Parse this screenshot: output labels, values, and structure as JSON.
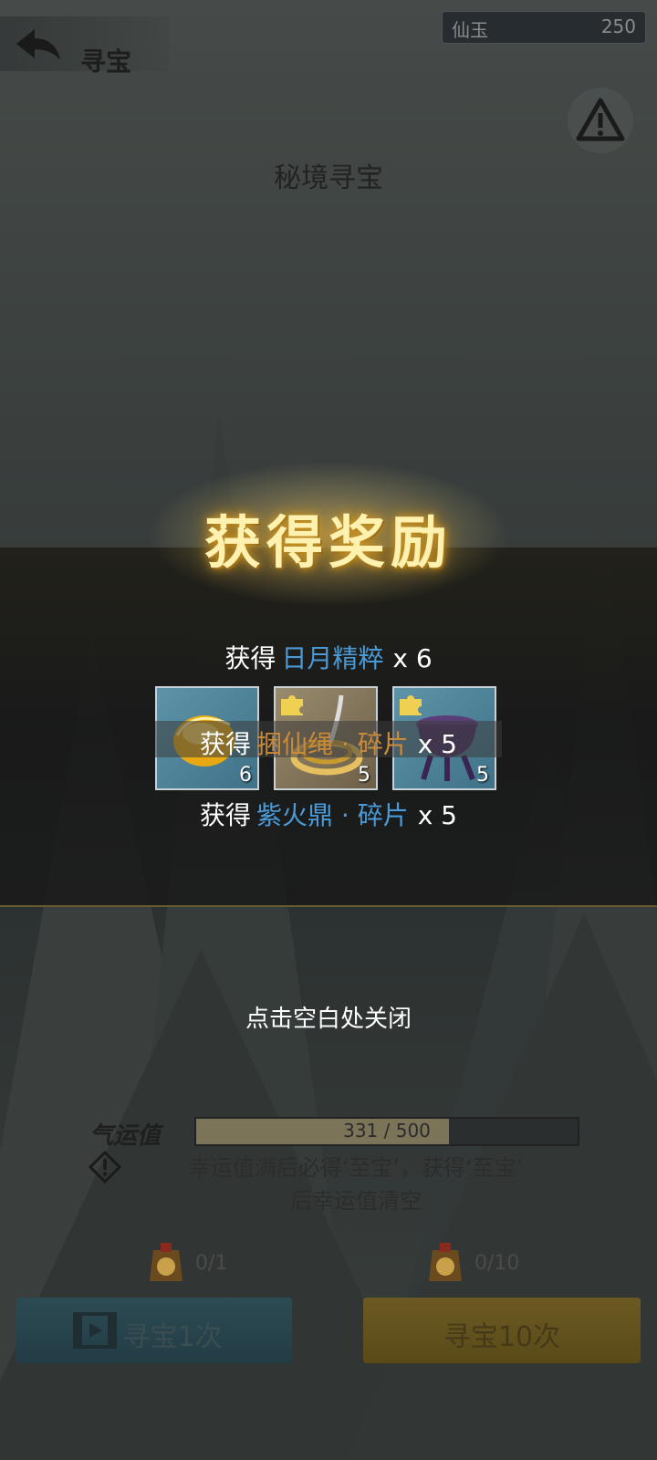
{
  "header": {
    "title": "寻宝",
    "currency_name": "仙玉",
    "currency_value": "250",
    "subtitle": "秘境寻宝"
  },
  "reward": {
    "title": "获得奖励",
    "lines": [
      {
        "prefix": "获得",
        "item": "日月精粹",
        "qty": "x 6",
        "item_color": "#4a9ad8"
      },
      {
        "prefix": "获得",
        "item": "捆仙绳 · 碎片",
        "qty": "x 5",
        "item_color": "#c98a3a"
      },
      {
        "prefix": "获得",
        "item": "紫火鼎 · 碎片",
        "qty": "x 5",
        "item_color": "#4a9ad8"
      }
    ],
    "items": [
      {
        "name": "gold-essence",
        "count": "6"
      },
      {
        "name": "rope-fragment",
        "count": "5"
      },
      {
        "name": "cauldron-fragment",
        "count": "5"
      }
    ],
    "close_hint": "点击空白处关闭"
  },
  "luck": {
    "label": "气运值",
    "value": "331 / 500",
    "fraction": 0.662,
    "note_line1": "幸运值满后必得‘至宝’，获得‘至宝’",
    "note_line2": "后幸运值清空"
  },
  "tokens": {
    "single": "0/1",
    "ten": "0/10"
  },
  "buttons": {
    "single": "寻宝1次",
    "ten": "寻宝10次"
  },
  "colors": {
    "gold_title": "#fff2b0",
    "blue_item": "#4a9ad8",
    "orange_item": "#c98a3a",
    "btn_teal": "#2d4b54",
    "btn_gold": "#6b5a22"
  }
}
